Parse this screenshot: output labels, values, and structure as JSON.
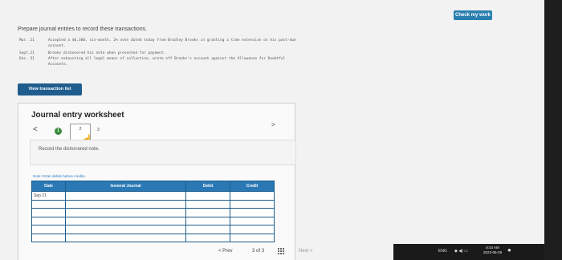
{
  "header": {
    "check_work_label": "Check my work"
  },
  "instruction": "Prepare journal entries to record these transactions.",
  "transactions": [
    {
      "date": "Mar. 21",
      "text": "Accepted a $6,300, six-month, 2% note dated today from Bradley Brooks in granting a time extension on his past-due"
    },
    {
      "date": "",
      "text": "account."
    },
    {
      "date": "Sept.21",
      "text": "Brooks dishonored his note when presented for payment."
    },
    {
      "date": "Dec. 31",
      "text": "After exhausting all legal means of collection, wrote off Brooks's account against the Allowance for Doubtful"
    },
    {
      "date": "",
      "text": "Accounts."
    }
  ],
  "view_transaction_label": "View transaction list",
  "worksheet": {
    "title": "Journal entry worksheet",
    "nav_prev": "<",
    "nav_next": ">",
    "steps": [
      "1",
      "2",
      "3"
    ],
    "record_text": "Record the dishonored note.",
    "note": "Note: Enter debits before credits.",
    "columns": [
      "Date",
      "General Journal",
      "Debit",
      "Credit"
    ],
    "rows": [
      [
        "Sep 21",
        "",
        "",
        ""
      ],
      [
        "",
        "",
        "",
        ""
      ],
      [
        "",
        "",
        "",
        ""
      ],
      [
        "",
        "",
        "",
        ""
      ],
      [
        "",
        "",
        "",
        ""
      ],
      [
        "",
        "",
        "",
        ""
      ]
    ]
  },
  "pagination": {
    "prev_label": "< Prev",
    "page_current": "3",
    "page_of": "of",
    "page_total": "3",
    "next_label": "Next >"
  },
  "taskbar": {
    "lang": "ENG",
    "time": "8:43 AM",
    "date": "2022-06-29"
  }
}
